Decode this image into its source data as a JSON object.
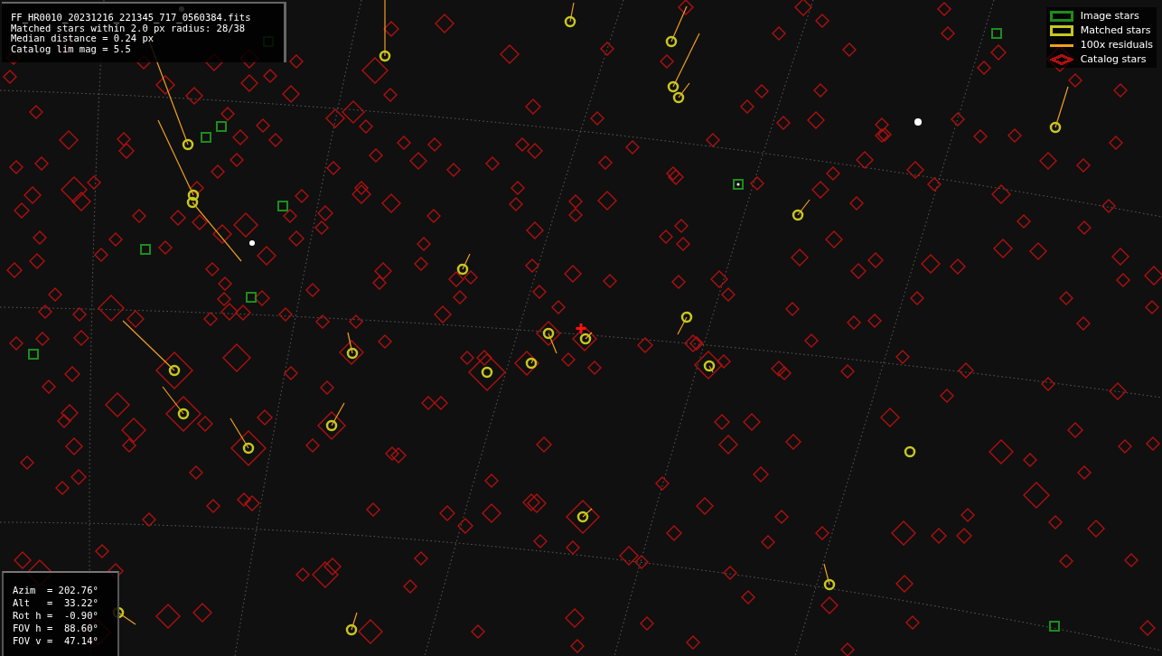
{
  "info_box": {
    "lines": [
      "FF_HR0010_20231216_221345_717_0560384.fits",
      "Matched stars within 2.0 px radius: 28/38",
      "Median distance = 0.24 px",
      "Catalog lim mag = 5.5"
    ]
  },
  "legend": [
    {
      "kind": "image",
      "label": "Image stars",
      "color": "#1e8c1e"
    },
    {
      "kind": "matched",
      "label": "Matched stars",
      "color": "#c8c81e"
    },
    {
      "kind": "residual",
      "label": "100x residuals",
      "color": "#f0a020"
    },
    {
      "kind": "catalog",
      "label": "Catalog stars",
      "color": "#b01010"
    }
  ],
  "pointing_box": {
    "lines": [
      "Azim  = 202.76°",
      "Alt   =  33.22°",
      "Rot h =  -0.90°",
      "FOV h =  88.60°",
      "FOV v =  47.14°"
    ]
  }
}
